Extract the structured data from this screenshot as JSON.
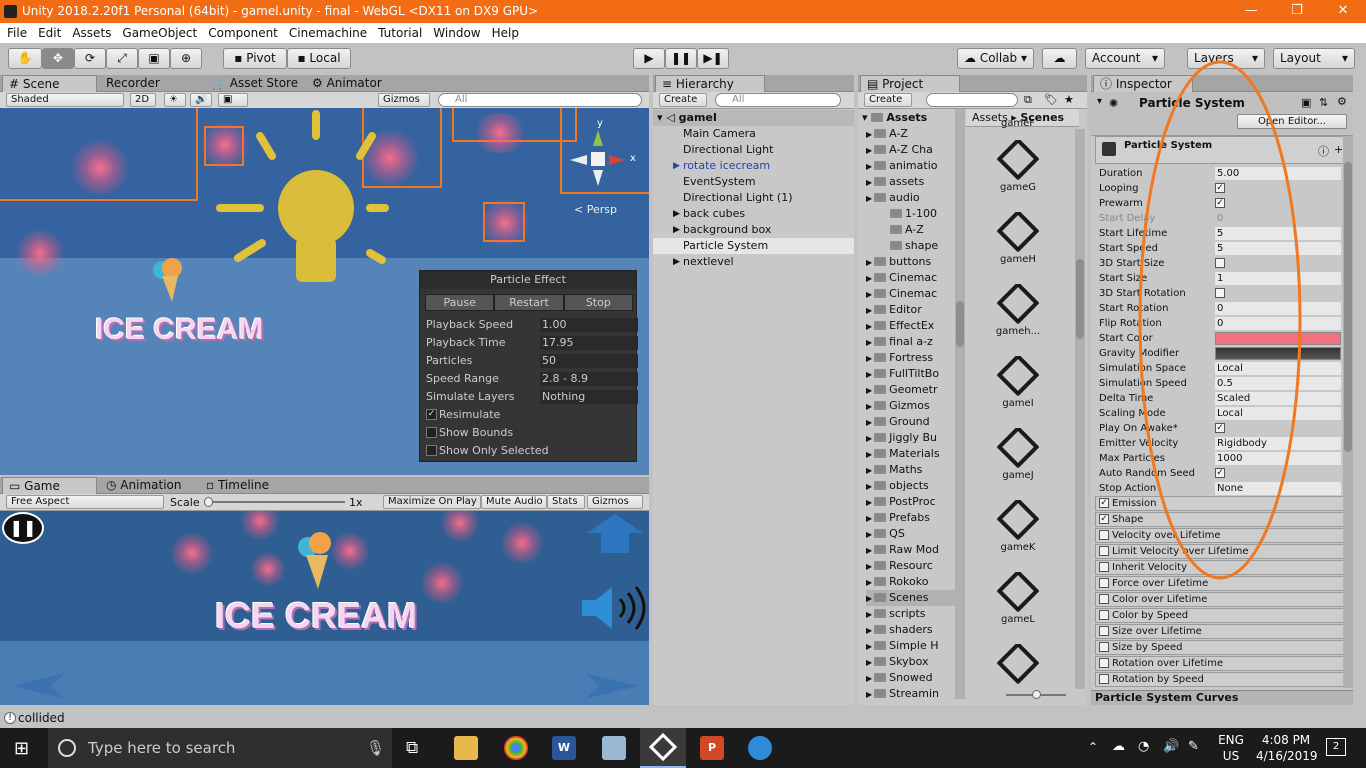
{
  "window": {
    "title": "Unity 2018.2.20f1 Personal (64bit) - gamel.unity - final - WebGL <DX11 on DX9 GPU>"
  },
  "menu": [
    "File",
    "Edit",
    "Assets",
    "GameObject",
    "Component",
    "Cinemachine",
    "Tutorial",
    "Window",
    "Help"
  ],
  "toolbar": {
    "pivot": "Pivot",
    "local": "Local",
    "collab": "Collab ▾",
    "account": "Account",
    "layers": "Layers",
    "layout": "Layout"
  },
  "scene": {
    "tabs": [
      "Scene",
      "Recorder",
      "Asset Store",
      "Animator"
    ],
    "shading": "Shaded",
    "mode2d": "2D",
    "gizmos": "Gizmos",
    "search": "All",
    "persp": "Persp",
    "axis_x": "x",
    "axis_y": "y",
    "title": "ICE CREAM"
  },
  "particle_effect": {
    "title": "Particle Effect",
    "buttons": [
      "Pause",
      "Restart",
      "Stop"
    ],
    "rows": [
      {
        "label": "Playback Speed",
        "value": "1.00"
      },
      {
        "label": "Playback Time",
        "value": "17.95"
      },
      {
        "label": "Particles",
        "value": "50"
      },
      {
        "label": "Speed Range",
        "value": "2.8 - 8.9"
      },
      {
        "label": "Simulate Layers",
        "value": "Nothing"
      }
    ],
    "checks": [
      {
        "label": "Resimulate",
        "checked": true
      },
      {
        "label": "Show Bounds",
        "checked": false
      },
      {
        "label": "Show Only Selected",
        "checked": false
      }
    ]
  },
  "game": {
    "tabs": [
      "Game",
      "Animation",
      "Timeline"
    ],
    "aspect": "Free Aspect",
    "scale_label": "Scale",
    "scale_value": "1x",
    "buttons": [
      "Maximize On Play",
      "Mute Audio",
      "Stats",
      "Gizmos"
    ],
    "title": "ICE CREAM"
  },
  "hierarchy": {
    "tab": "Hierarchy",
    "create": "Create",
    "search": "All",
    "scene": "gameI",
    "items": [
      {
        "label": "Main Camera",
        "arrow": false,
        "selected": false,
        "prefab": false
      },
      {
        "label": "Directional Light",
        "arrow": false,
        "selected": false,
        "prefab": false
      },
      {
        "label": "rotate icecream",
        "arrow": true,
        "selected": false,
        "prefab": true
      },
      {
        "label": "EventSystem",
        "arrow": false,
        "selected": false,
        "prefab": false
      },
      {
        "label": "Directional Light (1)",
        "arrow": false,
        "selected": false,
        "prefab": false
      },
      {
        "label": "back cubes",
        "arrow": true,
        "selected": false,
        "prefab": false
      },
      {
        "label": "background box",
        "arrow": true,
        "selected": false,
        "prefab": false
      },
      {
        "label": "Particle System",
        "arrow": false,
        "selected": true,
        "prefab": false
      },
      {
        "label": "nextlevel",
        "arrow": true,
        "selected": false,
        "prefab": false
      }
    ]
  },
  "project": {
    "tab": "Project",
    "create": "Create",
    "root": "Assets",
    "breadcrumb": [
      "Assets",
      "Scenes"
    ],
    "folders": [
      {
        "label": "A-Z",
        "indent": 1
      },
      {
        "label": "A-Z Cha",
        "indent": 1
      },
      {
        "label": "animatio",
        "indent": 1
      },
      {
        "label": "assets",
        "indent": 1
      },
      {
        "label": "audio",
        "indent": 1
      },
      {
        "label": "1-100",
        "indent": 2
      },
      {
        "label": "A-Z",
        "indent": 2
      },
      {
        "label": "shape",
        "indent": 2
      },
      {
        "label": "buttons",
        "indent": 1
      },
      {
        "label": "Cinemac",
        "indent": 1
      },
      {
        "label": "Cinemac",
        "indent": 1
      },
      {
        "label": "Editor",
        "indent": 1
      },
      {
        "label": "EffectEx",
        "indent": 1
      },
      {
        "label": "final a-z",
        "indent": 1
      },
      {
        "label": "Fortress",
        "indent": 1
      },
      {
        "label": "FullTiltBo",
        "indent": 1
      },
      {
        "label": "Geometr",
        "indent": 1
      },
      {
        "label": "Gizmos",
        "indent": 1
      },
      {
        "label": "Ground",
        "indent": 1
      },
      {
        "label": "Jiggly Bu",
        "indent": 1
      },
      {
        "label": "Materials",
        "indent": 1
      },
      {
        "label": "Maths",
        "indent": 1
      },
      {
        "label": "objects",
        "indent": 1
      },
      {
        "label": "PostProc",
        "indent": 1
      },
      {
        "label": "Prefabs",
        "indent": 1
      },
      {
        "label": "QS",
        "indent": 1
      },
      {
        "label": "Raw Mod",
        "indent": 1
      },
      {
        "label": "Resourc",
        "indent": 1
      },
      {
        "label": "Rokoko",
        "indent": 1
      },
      {
        "label": "Scenes",
        "indent": 1
      },
      {
        "label": "scripts",
        "indent": 1
      },
      {
        "label": "shaders",
        "indent": 1
      },
      {
        "label": "Simple H",
        "indent": 1
      },
      {
        "label": "Skybox",
        "indent": 1
      },
      {
        "label": "Snowed",
        "indent": 1
      },
      {
        "label": "Streamin",
        "indent": 1
      }
    ],
    "assets": [
      "gameF",
      "gameG",
      "gameH",
      "gameh...",
      "gameI",
      "gameJ",
      "gameK",
      "gameL",
      ""
    ]
  },
  "inspector": {
    "tab": "Inspector",
    "component": "Particle System",
    "open_editor": "Open Editor...",
    "module_main": "Particle System",
    "props": [
      {
        "label": "Duration",
        "value": "5.00",
        "type": "text"
      },
      {
        "label": "Looping",
        "value": "",
        "type": "check",
        "checked": true
      },
      {
        "label": "Prewarm",
        "value": "",
        "type": "check",
        "checked": true
      },
      {
        "label": "Start Delay",
        "value": "0",
        "type": "disabled"
      },
      {
        "label": "Start Lifetime",
        "value": "5",
        "type": "text"
      },
      {
        "label": "Start Speed",
        "value": "5",
        "type": "text"
      },
      {
        "label": "3D Start Size",
        "value": "",
        "type": "check",
        "checked": false
      },
      {
        "label": "Start Size",
        "value": "1",
        "type": "text"
      },
      {
        "label": "3D Start Rotation",
        "value": "",
        "type": "check",
        "checked": false
      },
      {
        "label": "Start Rotation",
        "value": "0",
        "type": "text"
      },
      {
        "label": "Flip Rotation",
        "value": "0",
        "type": "text"
      },
      {
        "label": "Start Color",
        "value": "",
        "type": "color"
      },
      {
        "label": "Gravity Modifier",
        "value": "",
        "type": "curve"
      },
      {
        "label": "Simulation Space",
        "value": "Local",
        "type": "dd"
      },
      {
        "label": "Simulation Speed",
        "value": "0.5",
        "type": "text"
      },
      {
        "label": "Delta Time",
        "value": "Scaled",
        "type": "dd"
      },
      {
        "label": "Scaling Mode",
        "value": "Local",
        "type": "dd"
      },
      {
        "label": "Play On Awake*",
        "value": "",
        "type": "check",
        "checked": true
      },
      {
        "label": "Emitter Velocity",
        "value": "Rigidbody",
        "type": "dd"
      },
      {
        "label": "Max Particles",
        "value": "1000",
        "type": "text"
      },
      {
        "label": "Auto Random Seed",
        "value": "",
        "type": "check",
        "checked": true
      },
      {
        "label": "Stop Action",
        "value": "None",
        "type": "dd"
      }
    ],
    "modules": [
      {
        "label": "Emission",
        "checked": true
      },
      {
        "label": "Shape",
        "checked": true
      },
      {
        "label": "Velocity over Lifetime",
        "checked": false
      },
      {
        "label": "Limit Velocity over Lifetime",
        "checked": false
      },
      {
        "label": "Inherit Velocity",
        "checked": false
      },
      {
        "label": "Force over Lifetime",
        "checked": false
      },
      {
        "label": "Color over Lifetime",
        "checked": false
      },
      {
        "label": "Color by Speed",
        "checked": false
      },
      {
        "label": "Size over Lifetime",
        "checked": false
      },
      {
        "label": "Size by Speed",
        "checked": false
      },
      {
        "label": "Rotation over Lifetime",
        "checked": false
      },
      {
        "label": "Rotation by Speed",
        "checked": false
      }
    ],
    "curves": "Particle System Curves",
    "start_color": "#f2707f"
  },
  "status": {
    "message": "collided"
  },
  "taskbar": {
    "search": "Type here to search",
    "lang1": "ENG",
    "lang2": "US",
    "time": "4:08 PM",
    "date": "4/16/2019",
    "notif": "2"
  },
  "colors": {
    "title_bar": "#f26c14",
    "annotation": "#f07820",
    "selection": "#8eb2e0"
  }
}
